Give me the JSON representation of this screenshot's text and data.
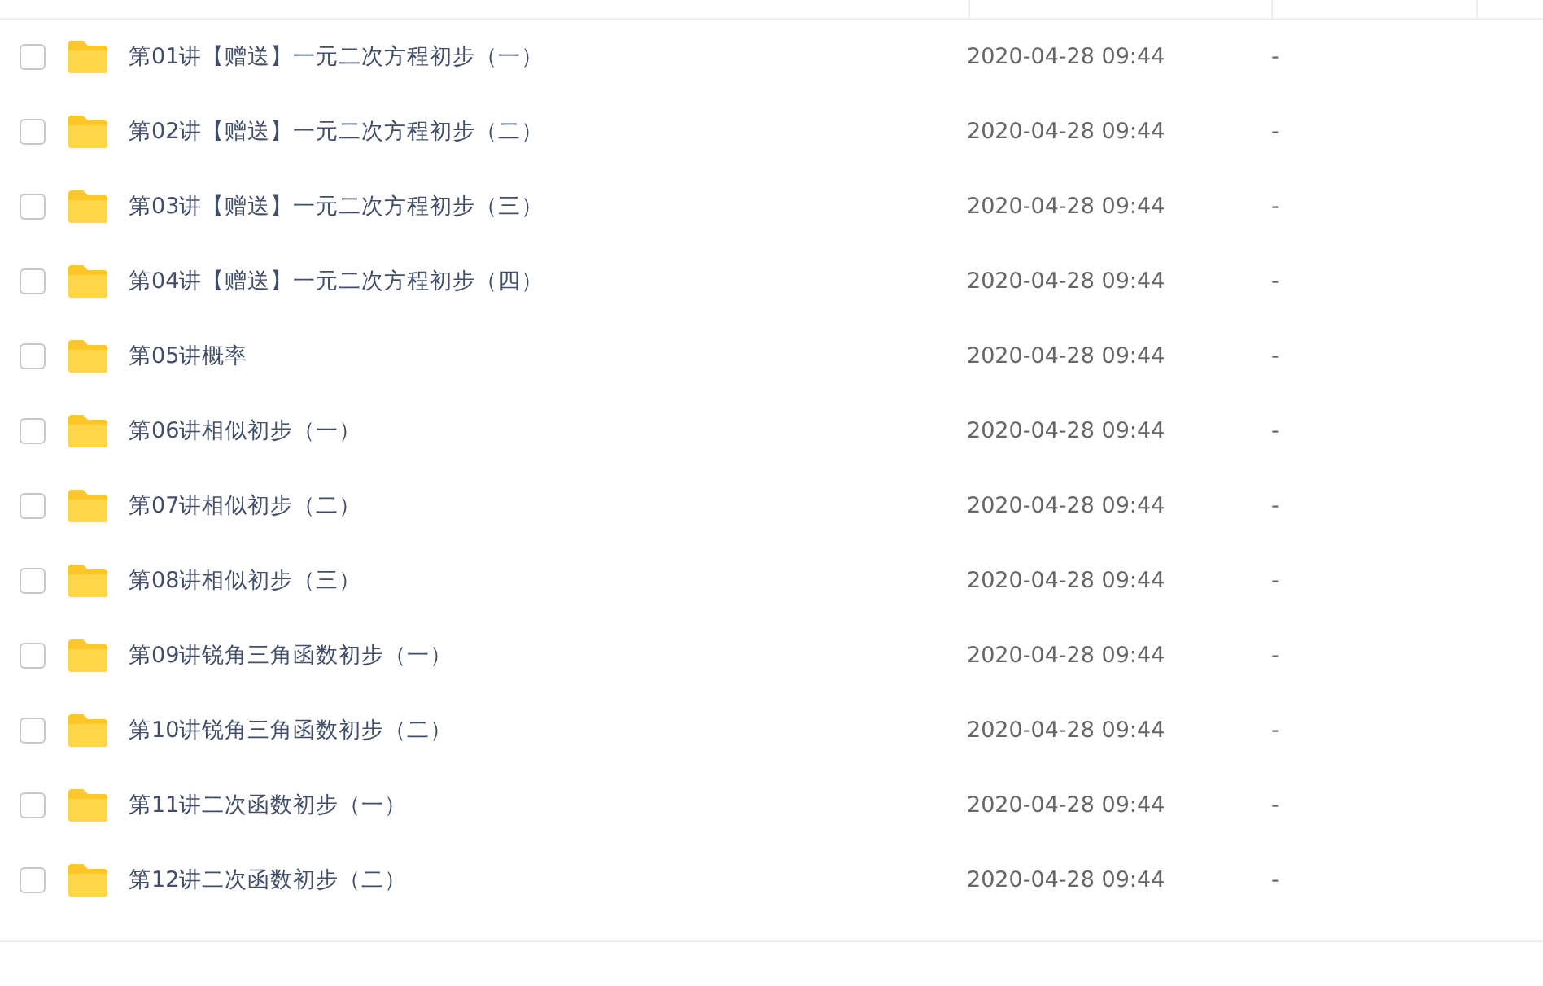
{
  "file_list": {
    "rows": [
      {
        "name": "第01讲【赠送】一元二次方程初步（一）",
        "modified": "2020-04-28 09:44",
        "size": "-",
        "checked": false
      },
      {
        "name": "第02讲【赠送】一元二次方程初步（二）",
        "modified": "2020-04-28 09:44",
        "size": "-",
        "checked": false
      },
      {
        "name": "第03讲【赠送】一元二次方程初步（三）",
        "modified": "2020-04-28 09:44",
        "size": "-",
        "checked": false
      },
      {
        "name": "第04讲【赠送】一元二次方程初步（四）",
        "modified": "2020-04-28 09:44",
        "size": "-",
        "checked": false
      },
      {
        "name": "第05讲概率",
        "modified": "2020-04-28 09:44",
        "size": "-",
        "checked": false
      },
      {
        "name": "第06讲相似初步（一）",
        "modified": "2020-04-28 09:44",
        "size": "-",
        "checked": false
      },
      {
        "name": "第07讲相似初步（二）",
        "modified": "2020-04-28 09:44",
        "size": "-",
        "checked": false
      },
      {
        "name": "第08讲相似初步（三）",
        "modified": "2020-04-28 09:44",
        "size": "-",
        "checked": false
      },
      {
        "name": "第09讲锐角三角函数初步（一）",
        "modified": "2020-04-28 09:44",
        "size": "-",
        "checked": false
      },
      {
        "name": "第10讲锐角三角函数初步（二）",
        "modified": "2020-04-28 09:44",
        "size": "-",
        "checked": false
      },
      {
        "name": "第11讲二次函数初步（一）",
        "modified": "2020-04-28 09:44",
        "size": "-",
        "checked": false
      },
      {
        "name": "第12讲二次函数初步（二）",
        "modified": "2020-04-28 09:44",
        "size": "-",
        "checked": false
      }
    ]
  }
}
